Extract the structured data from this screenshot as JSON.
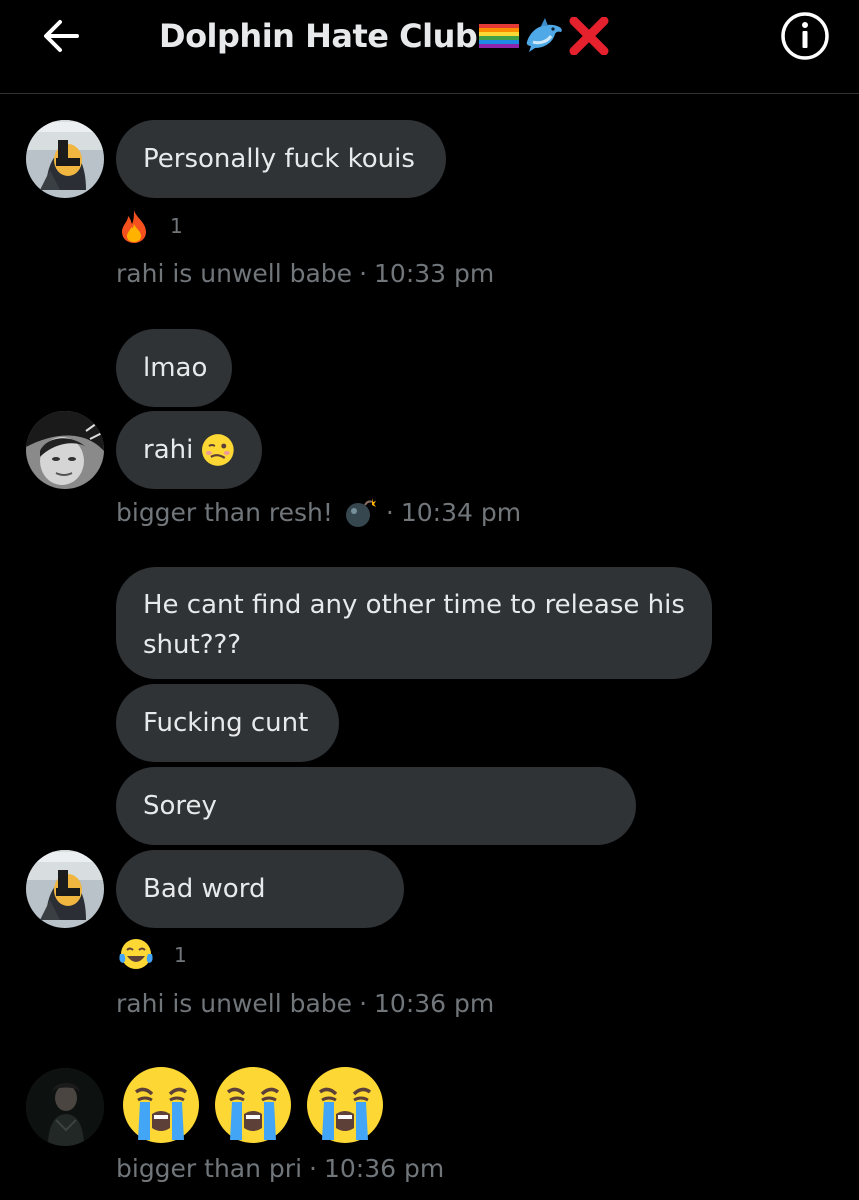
{
  "header": {
    "title": "Dolphin Hate Club",
    "title_emojis": [
      "rainbow-flag",
      "dolphin",
      "red-x"
    ],
    "back_icon": "arrow-left-icon",
    "info_icon": "info-icon"
  },
  "colors": {
    "background": "#000000",
    "bubble": "#2f3336",
    "text": "#e7e9ea",
    "muted": "#71767b"
  },
  "messages": {
    "m1": {
      "text": "Personally fuck kouis"
    },
    "m1_reaction": {
      "emoji": "fire",
      "count": "1"
    },
    "m1_meta": {
      "sender": "rahi is unwell babe",
      "sep": "·",
      "time": "10:33 pm"
    },
    "m2": {
      "text": "lmao"
    },
    "m3": {
      "text": "rahi",
      "emoji": "woozy-face"
    },
    "m3_meta": {
      "sender": "bigger than resh!",
      "sender_emoji": "bomb",
      "sep": "·",
      "time": "10:34 pm"
    },
    "m4": {
      "text": "He cant find any other time to release his\nshut???"
    },
    "m5": {
      "text": "Fucking cunt"
    },
    "m6": {
      "text": "Sorey"
    },
    "m7": {
      "text": "Bad word"
    },
    "m7_reaction": {
      "emoji": "tears-of-joy",
      "count": "1"
    },
    "m7_meta": {
      "sender": "rahi is unwell babe",
      "sep": "·",
      "time": "10:36 pm"
    },
    "m8": {
      "emojis": [
        "loudly-crying-face",
        "loudly-crying-face",
        "loudly-crying-face"
      ]
    },
    "m8_meta": {
      "sender": "bigger than pri",
      "sep": "·",
      "time": "10:36 pm"
    }
  }
}
